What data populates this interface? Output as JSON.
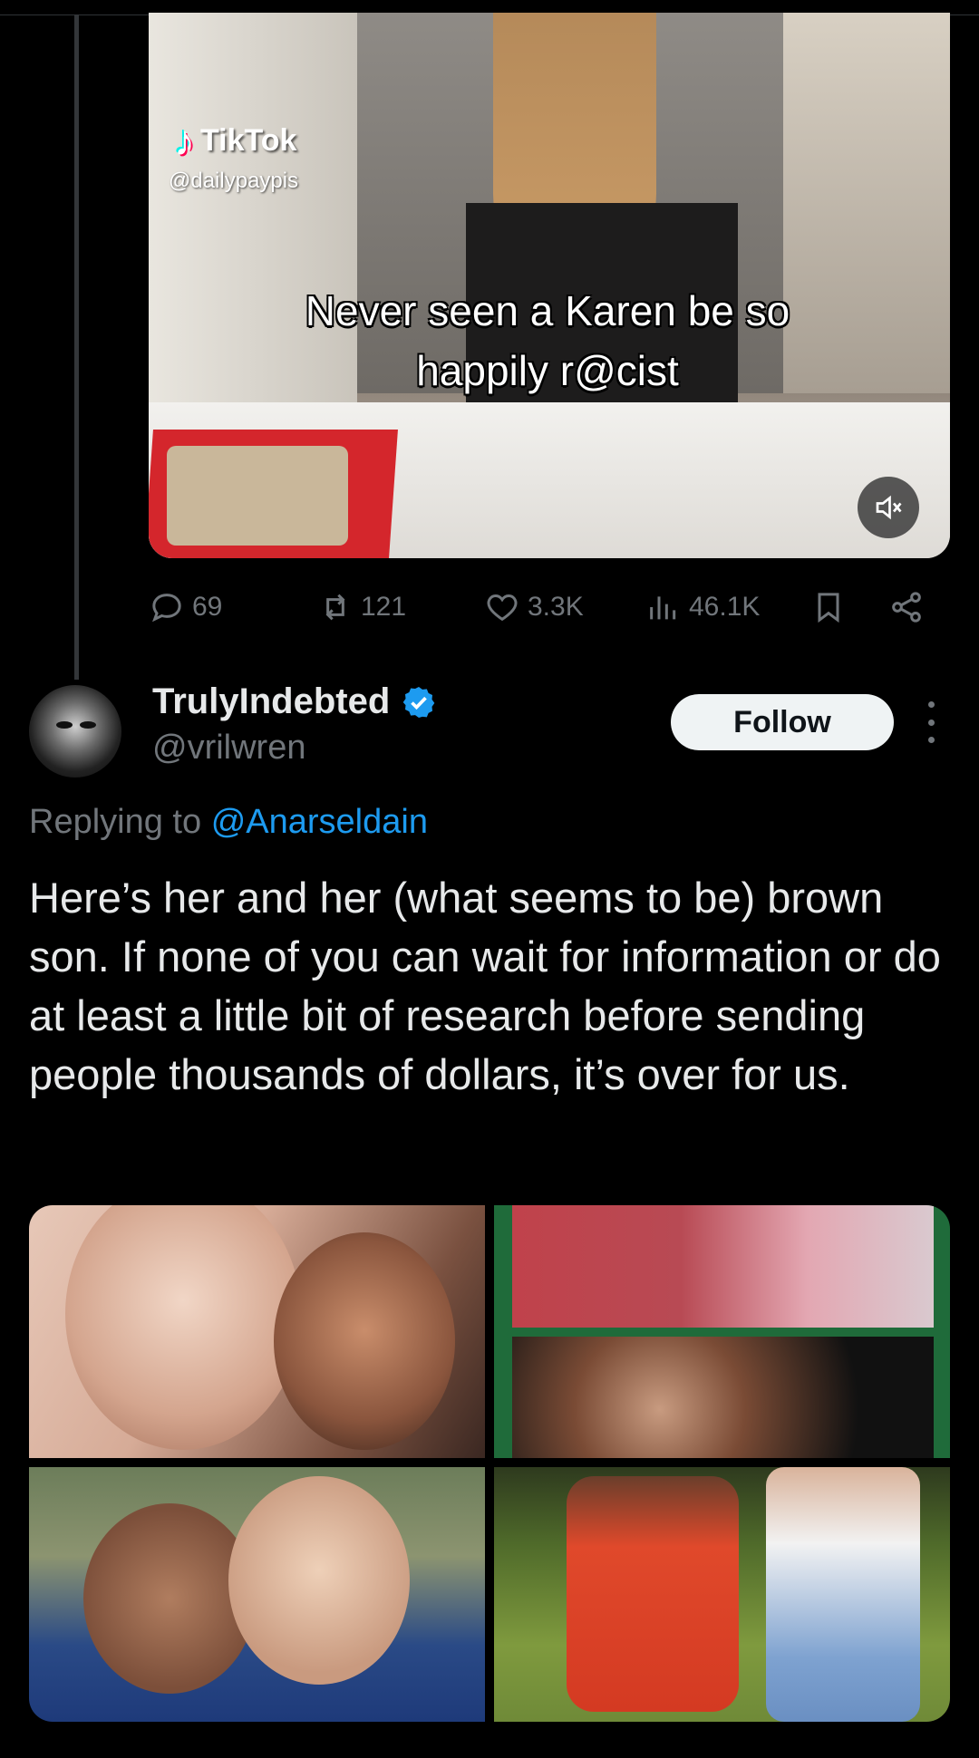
{
  "video": {
    "watermark_brand": "TikTok",
    "watermark_handle": "@dailypaypis",
    "caption_line1": "Never seen a Karen be so",
    "caption_line2": "happily r@cist",
    "mute_icon": "speaker-muted-icon"
  },
  "actions": {
    "replies": "69",
    "reposts": "121",
    "likes": "3.3K",
    "views": "46.1K"
  },
  "reply_tweet": {
    "display_name": "TrulyIndebted",
    "handle": "@vrilwren",
    "verified": true,
    "follow_label": "Follow",
    "replying_prefix": "Replying to",
    "replying_to": "@Anarseldain",
    "text": "Here’s her and her (what seems to be) brown son. If none of you can wait for information or do at least a little bit of research before sending people thousands of dollars, it’s over for us."
  },
  "colors": {
    "background": "#000000",
    "text": "#e7e9ea",
    "muted": "#71767b",
    "accent": "#1d9bf0",
    "follow_bg": "#eff3f4"
  }
}
